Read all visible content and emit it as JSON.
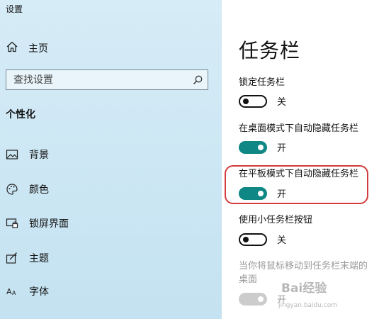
{
  "window": {
    "title": "设置"
  },
  "sidebar": {
    "home_label": "主页",
    "search_placeholder": "查找设置",
    "section_title": "个性化",
    "items": [
      {
        "label": "背景",
        "icon": "picture-icon"
      },
      {
        "label": "颜色",
        "icon": "palette-icon"
      },
      {
        "label": "锁屏界面",
        "icon": "lock-screen-icon"
      },
      {
        "label": "主题",
        "icon": "theme-icon"
      },
      {
        "label": "字体",
        "icon": "font-icon"
      }
    ]
  },
  "main": {
    "title": "任务栏",
    "settings": [
      {
        "label": "锁定任务栏",
        "state": "关",
        "on": false,
        "enabled": true
      },
      {
        "label": "在桌面模式下自动隐藏任务栏",
        "state": "开",
        "on": true,
        "enabled": true
      },
      {
        "label": "在平板模式下自动隐藏任务栏",
        "state": "开",
        "on": true,
        "enabled": true
      },
      {
        "label": "使用小任务栏按钮",
        "state": "关",
        "on": false,
        "enabled": true
      },
      {
        "label_line1": "当你将鼠标移动到任务栏末端的",
        "label_line2": "桌面",
        "state": "开",
        "on": true,
        "enabled": false
      }
    ]
  },
  "watermark": {
    "text": "Bai经验",
    "sub": "jingyan.baidu.com"
  },
  "colors": {
    "accent": "#0f8784",
    "highlight": "#d23b3b",
    "sidebar_bg": "#c9e5f3"
  }
}
